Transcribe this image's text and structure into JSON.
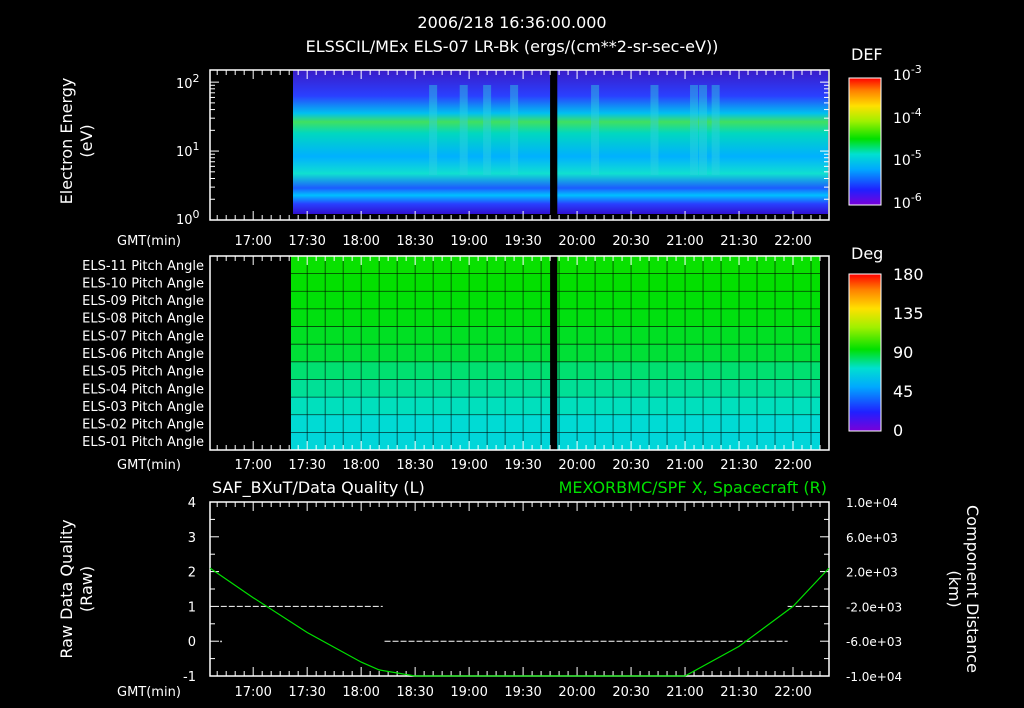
{
  "header": {
    "timestamp": "2006/218 16:36:00.000",
    "subtitle": "ELSSCIL/MEx ELS-07 LR-Bk  (ergs/(cm**2-sr-sec-eV))"
  },
  "time_axis": {
    "label": "GMT(min)",
    "ticks": [
      "17:00",
      "17:30",
      "18:00",
      "18:30",
      "19:00",
      "19:30",
      "20:00",
      "20:30",
      "21:00",
      "21:30",
      "22:00"
    ]
  },
  "chart_data": [
    {
      "type": "heatmap",
      "title": "ELSSCIL/MEx ELS-07 LR-Bk  (ergs/(cm**2-sr-sec-eV))",
      "ylabel": [
        "Electron Energy",
        "(eV)"
      ],
      "xlabel": "GMT(min)",
      "y_scale": "log",
      "ylim_eV": [
        1,
        150
      ],
      "y_ticks": [
        {
          "base": "10",
          "exp": "0"
        },
        {
          "base": "10",
          "exp": "1"
        },
        {
          "base": "10",
          "exp": "2"
        }
      ],
      "x_range": [
        "16:36",
        "22:20"
      ],
      "data_start": "17:21",
      "data_gap": [
        "19:45",
        "19:49"
      ],
      "colorbar": {
        "label": "DEF",
        "scale": "log",
        "ticks": [
          {
            "base": "10",
            "exp": "-3"
          },
          {
            "base": "10",
            "exp": "-4"
          },
          {
            "base": "10",
            "exp": "-5"
          },
          {
            "base": "10",
            "exp": "-6"
          }
        ]
      }
    },
    {
      "type": "heatmap",
      "title": "",
      "xlabel": "GMT(min)",
      "rows": [
        "ELS-11 Pitch Angle",
        "ELS-10 Pitch Angle",
        "ELS-09 Pitch Angle",
        "ELS-08 Pitch Angle",
        "ELS-07 Pitch Angle",
        "ELS-06 Pitch Angle",
        "ELS-05 Pitch Angle",
        "ELS-04 Pitch Angle",
        "ELS-03 Pitch Angle",
        "ELS-02 Pitch Angle",
        "ELS-01 Pitch Angle"
      ],
      "row_values_deg": [
        95,
        94,
        93,
        92,
        90,
        88,
        82,
        78,
        74,
        70,
        68
      ],
      "data_range": [
        "17:21",
        "22:15"
      ],
      "data_gap": [
        "19:45",
        "19:49"
      ],
      "colorbar": {
        "label": "Deg",
        "ticks": [
          "180",
          "135",
          "90",
          "45",
          "0"
        ],
        "range": [
          0,
          180
        ]
      }
    },
    {
      "type": "line",
      "left_title": "SAF_BXuT/Data Quality (L)",
      "right_title": "MEXORBMC/SPF X, Spacecraft (R)",
      "ylabel_left": [
        "Raw Data Quality",
        "(Raw)"
      ],
      "ylabel_right": [
        "Component Distance",
        "(km)"
      ],
      "xlabel": "GMT(min)",
      "ylim_left": [
        -1,
        4
      ],
      "left_ticks": [
        "4",
        "3",
        "2",
        "1",
        "0",
        "-1"
      ],
      "ylim_right": [
        -10000,
        10000
      ],
      "right_ticks": [
        "1.0e+04",
        "6.0e+03",
        "2.0e+03",
        "-2.0e+03",
        "-6.0e+03",
        "-1.0e+04"
      ],
      "series": [
        {
          "name": "SAF_BXuT/Data Quality",
          "axis": "left",
          "color": "#ffffff",
          "segments": [
            {
              "x": [
                "16:42",
                "18:12"
              ],
              "y": 1
            },
            {
              "x": [
                "18:13",
                "21:57"
              ],
              "y": 0
            },
            {
              "x": [
                "21:57",
                "22:18"
              ],
              "y": 1
            }
          ],
          "points": [
            {
              "x": "16:42",
              "y": 0
            }
          ]
        },
        {
          "name": "MEXORBMC/SPF X, Spacecraft",
          "axis": "right",
          "color": "#00e000",
          "x": [
            "16:36",
            "17:00",
            "17:30",
            "18:00",
            "18:10",
            "18:30",
            "19:00",
            "20:30",
            "21:00",
            "21:30",
            "22:00",
            "22:20"
          ],
          "y": [
            2400,
            -1000,
            -5000,
            -8400,
            -9300,
            -10400,
            -10600,
            -10600,
            -10200,
            -6600,
            -2000,
            2400
          ]
        }
      ]
    }
  ]
}
